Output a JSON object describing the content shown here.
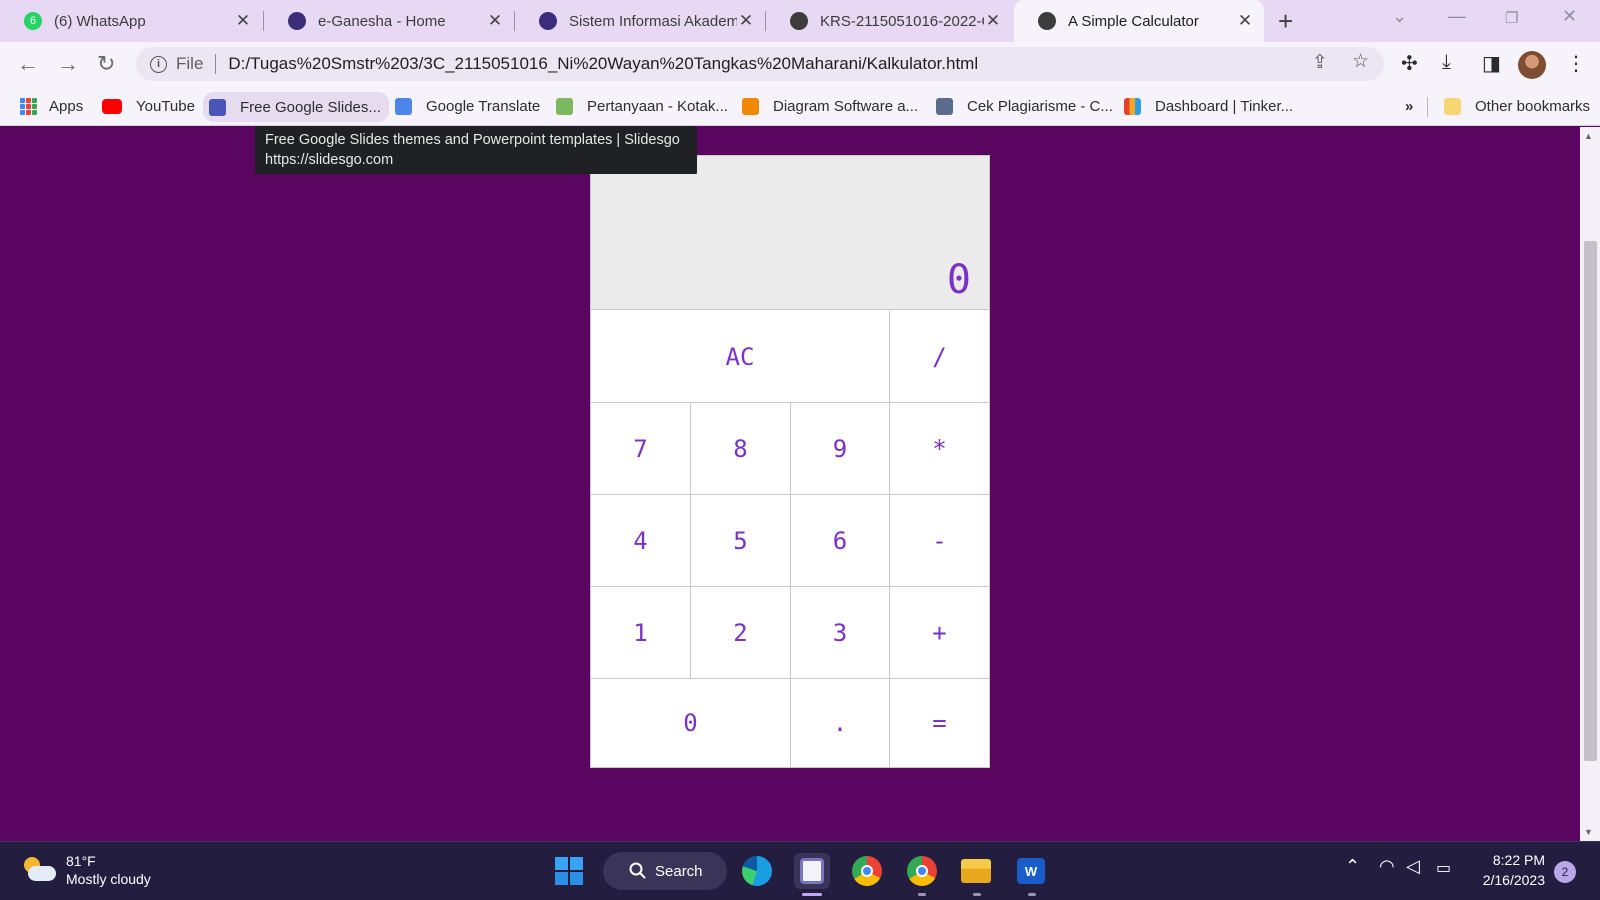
{
  "browser": {
    "tabs": [
      {
        "title": "(6) WhatsApp",
        "favicon_badge": "6",
        "active": false
      },
      {
        "title": "e-Ganesha - Home",
        "active": false
      },
      {
        "title": "Sistem Informasi Akadem",
        "active": false
      },
      {
        "title": "KRS-2115051016-2022-G",
        "active": false
      },
      {
        "title": "A Simple Calculator",
        "active": true
      }
    ],
    "new_tab_label": "+",
    "close_glyph": "✕",
    "address": {
      "scheme_label": "File",
      "url": "D:/Tugas%20Smstr%203/3C_2115051016_Ni%20Wayan%20Tangkas%20Maharani/Kalkulator.html"
    },
    "bookmarks": [
      {
        "label": "Apps",
        "icon": "apps-grid-icon"
      },
      {
        "label": "YouTube",
        "icon": "youtube-icon"
      },
      {
        "label": "Free Google Slides...",
        "icon": "slides-icon"
      },
      {
        "label": "Google Translate",
        "icon": "translate-icon"
      },
      {
        "label": "Pertanyaan - Kotak...",
        "icon": "box-icon"
      },
      {
        "label": "Diagram Software a...",
        "icon": "diagram-icon"
      },
      {
        "label": "Cek Plagiarisme - C...",
        "icon": "plagiarism-icon"
      },
      {
        "label": "Dashboard | Tinker...",
        "icon": "tinkercad-icon"
      }
    ],
    "overflow_label": "»",
    "other_bookmarks_label": "Other bookmarks",
    "tooltip": {
      "line1": "Free Google Slides themes and Powerpoint templates | Slidesgo",
      "line2": "https://slidesgo.com"
    }
  },
  "calculator": {
    "display": "0",
    "keys": {
      "ac": "AC",
      "divide": "/",
      "seven": "7",
      "eight": "8",
      "nine": "9",
      "multiply": "*",
      "four": "4",
      "five": "5",
      "six": "6",
      "minus": "-",
      "one": "1",
      "two": "2",
      "three": "3",
      "plus": "+",
      "zero": "0",
      "dot": ".",
      "equals": "="
    }
  },
  "taskbar": {
    "weather_temp": "81°F",
    "weather_desc": "Mostly cloudy",
    "search_label": "Search",
    "time": "8:22 PM",
    "date": "2/16/2023",
    "notification_count": "2"
  },
  "colors": {
    "page_bg": "#5a0560",
    "key_text": "#7b30c7",
    "tab_strip": "#e7d9f3"
  }
}
